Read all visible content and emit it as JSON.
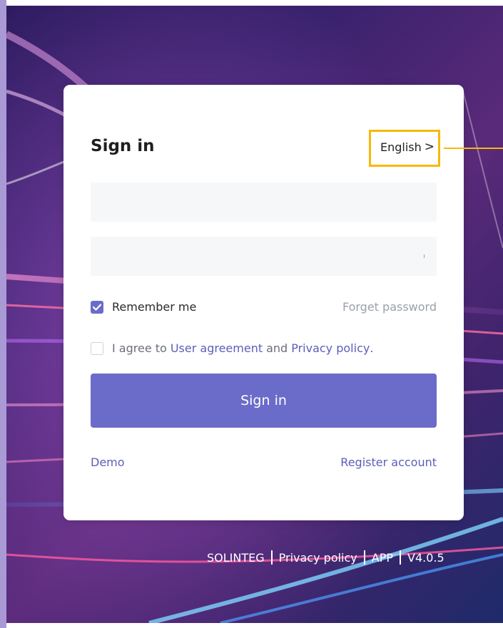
{
  "card": {
    "title": "Sign in",
    "language": "English",
    "language_chevron": ">",
    "username": {
      "value": "",
      "placeholder": ""
    },
    "password": {
      "value": "",
      "placeholder": ""
    },
    "remember_me": {
      "label": "Remember me",
      "checked": true
    },
    "forget_password": "Forget password",
    "agreement": {
      "prefix": "I agree to",
      "user_agreement": "User agreement",
      "middle": "and",
      "privacy_policy": "Privacy policy",
      "suffix": ".",
      "checked": false
    },
    "sign_in_button": "Sign in",
    "demo_link": "Demo",
    "register_link": "Register account"
  },
  "footer": {
    "items": [
      "SOLINTEG",
      "Privacy policy",
      "APP",
      "V4.0.5"
    ]
  },
  "colors": {
    "accent": "#6b6cc9",
    "link": "#5b5fb8",
    "highlight": "#f5b90a",
    "input_bg": "#f6f7f9"
  },
  "icons": {
    "remember_checkbox": "checkmark-icon",
    "language_chevron": "chevron-right-icon"
  }
}
